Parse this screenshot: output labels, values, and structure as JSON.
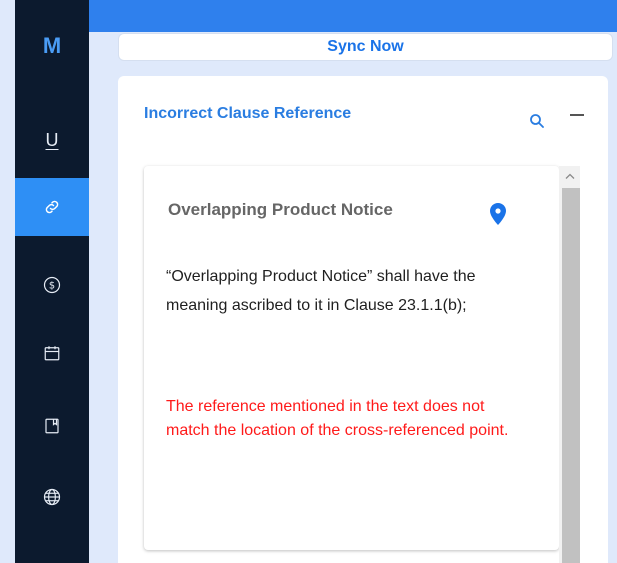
{
  "rail": {
    "logo": "M",
    "items": [
      {
        "name": "underline-icon",
        "label": "U",
        "active": false
      },
      {
        "name": "link-icon",
        "active": true
      },
      {
        "name": "dollar-icon",
        "active": false
      },
      {
        "name": "calendar-icon",
        "active": false
      },
      {
        "name": "bookmark-icon",
        "active": false
      },
      {
        "name": "globe-icon",
        "active": false
      }
    ]
  },
  "sync_label": "Sync Now",
  "panel": {
    "title": "Incorrect Clause Reference",
    "card": {
      "heading": "Overlapping Product Notice",
      "body": "“Overlapping Product Notice” shall have the meaning ascribed to it in Clause 23.1.1(b);",
      "issue": "The reference mentioned in the text does not match the location of the cross-referenced point."
    }
  },
  "colors": {
    "rail_bg": "#0c1a2e",
    "accent": "#2e8ff5",
    "title_blue": "#2a7de1",
    "issue_red": "#ff1a1a"
  }
}
